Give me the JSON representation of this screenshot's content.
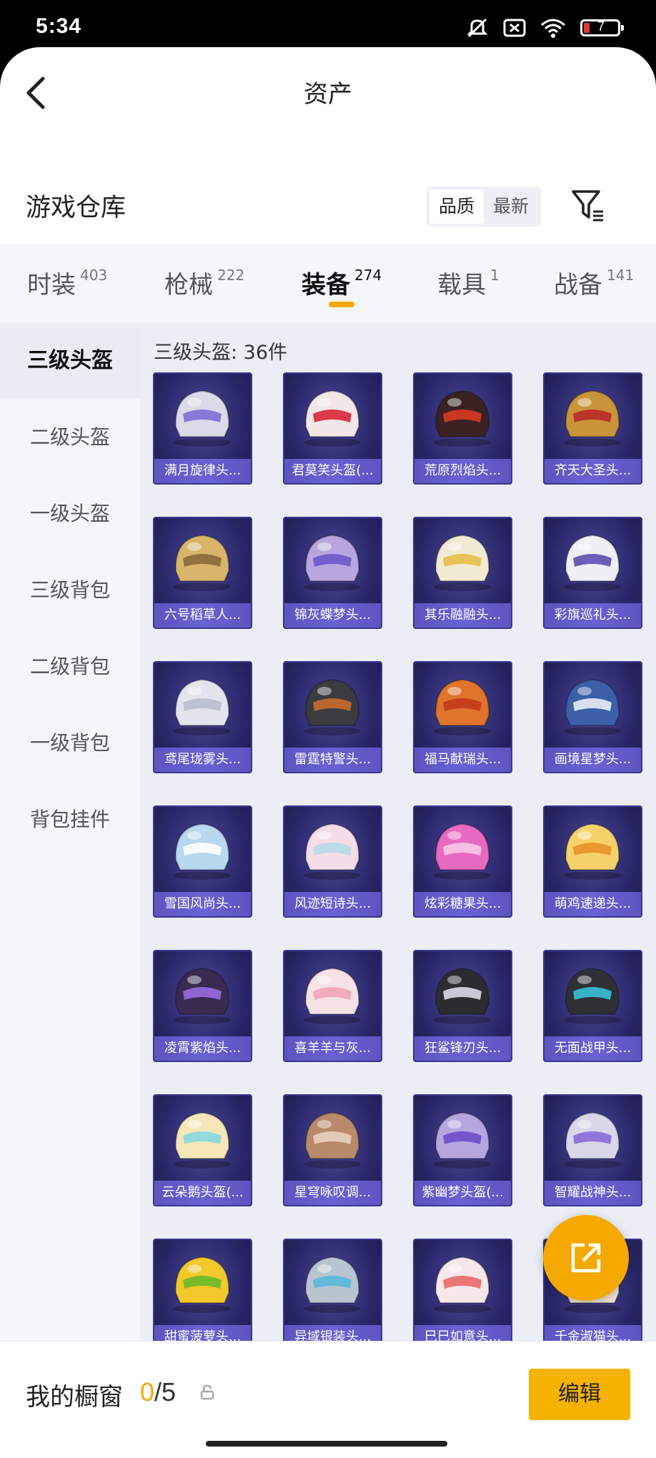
{
  "status_bar": {
    "time": "5:34",
    "battery": "7",
    "battery_color": "#e53935"
  },
  "nav": {
    "title": "资产"
  },
  "warehouse": {
    "title": "游戏仓库",
    "sort_options": [
      {
        "label": "品质",
        "active": true
      },
      {
        "label": "最新",
        "active": false
      }
    ]
  },
  "category_tabs": [
    {
      "label": "时装",
      "count": "403",
      "active": false
    },
    {
      "label": "枪械",
      "count": "222",
      "active": false
    },
    {
      "label": "装备",
      "count": "274",
      "active": true
    },
    {
      "label": "载具",
      "count": "1",
      "active": false
    },
    {
      "label": "战备",
      "count": "141",
      "active": false
    }
  ],
  "sidebar": {
    "items": [
      {
        "label": "三级头盔",
        "active": true
      },
      {
        "label": "二级头盔",
        "active": false
      },
      {
        "label": "一级头盔",
        "active": false
      },
      {
        "label": "三级背包",
        "active": false
      },
      {
        "label": "二级背包",
        "active": false
      },
      {
        "label": "一级背包",
        "active": false
      },
      {
        "label": "背包挂件",
        "active": false
      }
    ]
  },
  "content": {
    "heading": "三级头盔: 36件",
    "items": [
      {
        "name": "满月旋律头...",
        "color": "#d9dbe8",
        "accent": "#7b6fd6"
      },
      {
        "name": "君莫笑头盔(...",
        "color": "#f2e6e6",
        "accent": "#d9263a"
      },
      {
        "name": "荒原烈焰头...",
        "color": "#3a2222",
        "accent": "#d93a24"
      },
      {
        "name": "齐天大圣头...",
        "color": "#c9953a",
        "accent": "#b8292a"
      },
      {
        "name": "六号稻草人...",
        "color": "#d8b56a",
        "accent": "#8a6a3a"
      },
      {
        "name": "锦灰蝶梦头...",
        "color": "#b9a6e0",
        "accent": "#6e58c8"
      },
      {
        "name": "其乐融融头...",
        "color": "#f3ead2",
        "accent": "#e6c04a"
      },
      {
        "name": "彩旗巡礼头...",
        "color": "#eef0f6",
        "accent": "#5b4fb0"
      },
      {
        "name": "鸢尾珑雾头...",
        "color": "#e2e4ee",
        "accent": "#b8bcd0"
      },
      {
        "name": "雷霆特警头...",
        "color": "#3a3c40",
        "accent": "#c96a2a"
      },
      {
        "name": "福马献瑞头...",
        "color": "#e0742a",
        "accent": "#c23a1e"
      },
      {
        "name": "画境星梦头...",
        "color": "#3c5fa8",
        "accent": "#e8eef8"
      },
      {
        "name": "雪国风尚头...",
        "color": "#b8d8f0",
        "accent": "#ffffff"
      },
      {
        "name": "风迹短诗头...",
        "color": "#f4dde8",
        "accent": "#b8d8ea"
      },
      {
        "name": "炫彩糖果头...",
        "color": "#e86ac0",
        "accent": "#f8c8e8"
      },
      {
        "name": "萌鸡速递头...",
        "color": "#f6d36a",
        "accent": "#e8922a"
      },
      {
        "name": "凌霄紫焰头...",
        "color": "#3a2a52",
        "accent": "#9a6ae0"
      },
      {
        "name": "喜羊羊与灰...",
        "color": "#f6e2e6",
        "accent": "#f2a6b8"
      },
      {
        "name": "狂鲨锋刃头...",
        "color": "#2a2c32",
        "accent": "#d8dce6"
      },
      {
        "name": "无面战甲头...",
        "color": "#2e3036",
        "accent": "#3ac0d8"
      },
      {
        "name": "云朵鹅头盔(...",
        "color": "#f6e6b8",
        "accent": "#8ad8e0"
      },
      {
        "name": "星穹咏叹调...",
        "color": "#b88a6a",
        "accent": "#e8d0c0"
      },
      {
        "name": "紫幽梦头盔(...",
        "color": "#b6a6e0",
        "accent": "#6e4ec8"
      },
      {
        "name": "智耀战神头...",
        "color": "#d8d6e8",
        "accent": "#8a6ad8"
      },
      {
        "name": "甜蜜菠萝头...",
        "color": "#f2c82a",
        "accent": "#6ab82a"
      },
      {
        "name": "异域银装头...",
        "color": "#b8c4d0",
        "accent": "#5ab8d8"
      },
      {
        "name": "巳巳如意头...",
        "color": "#f6e8e8",
        "accent": "#e86a6a"
      },
      {
        "name": "千金淑猫头...",
        "color": "#f4e6d8",
        "accent": "#e8b0a0"
      }
    ]
  },
  "bottom": {
    "title": "我的橱窗",
    "current": "0",
    "separator": "/",
    "max": "5",
    "edit_label": "编辑"
  },
  "colors": {
    "accent": "#f5a900",
    "card_bg": "#2a2769",
    "card_label": "#6a62d4"
  }
}
